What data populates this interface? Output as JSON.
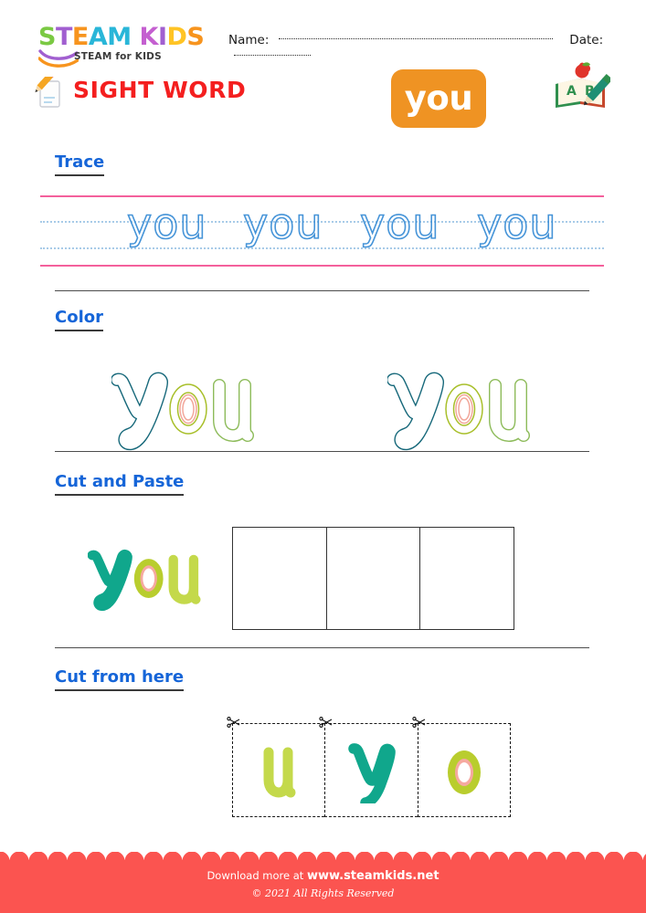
{
  "brand": {
    "logo_letters": [
      {
        "ch": "S",
        "color": "#7ac943"
      },
      {
        "ch": "T",
        "color": "#a15fd0"
      },
      {
        "ch": "E",
        "color": "#f7941e"
      },
      {
        "ch": "A",
        "color": "#29b6d8"
      },
      {
        "ch": "M",
        "color": "#29b6d8"
      },
      {
        "ch": " ",
        "color": "#ffffff"
      },
      {
        "ch": "K",
        "color": "#c45fd0"
      },
      {
        "ch": "I",
        "color": "#a15fd0"
      },
      {
        "ch": "D",
        "color": "#ffc425"
      },
      {
        "ch": "S",
        "color": "#f7941e"
      }
    ],
    "logo_text": "STEAM KIDS",
    "tagline": "STEAM for KIDS"
  },
  "header": {
    "name_label": "Name:",
    "date_label": "Date:",
    "name_value": "",
    "date_value": "",
    "title": "SIGHT WORD",
    "title_color": "#f41f1f",
    "word_badge": "you",
    "word_badge_color": "#ef9323",
    "pencil_icon": "pencil-paper-icon",
    "abc_icon": "abc-book-apple-pencil-icon"
  },
  "sections": [
    {
      "id": "trace",
      "label": "Trace"
    },
    {
      "id": "color",
      "label": "Color"
    },
    {
      "id": "cut-and-paste",
      "label": "Cut and Paste"
    },
    {
      "id": "cut-from-here",
      "label": "Cut from here"
    }
  ],
  "trace": {
    "label": "Trace",
    "word": "you",
    "repetitions": 4,
    "words": [
      "you",
      "you",
      "you",
      "you"
    ],
    "rule_color": "#f4609c",
    "guide_color": "#a8cbe8",
    "stroke_color": "#3d8fd6"
  },
  "color": {
    "label": "Color",
    "word": "you",
    "repetitions": 2,
    "letters": [
      {
        "ch": "y",
        "outline": "#16687a"
      },
      {
        "ch": "o",
        "outline": "#a8bf2a",
        "inner_outline": "#f2a79a"
      },
      {
        "ch": "u",
        "outline": "#8dbb5a"
      }
    ]
  },
  "cut_and_paste": {
    "label": "Cut and Paste",
    "word": "you",
    "letters": [
      {
        "ch": "y",
        "fill": "#10a78c"
      },
      {
        "ch": "o",
        "fill": "#b9cd2e",
        "inner_fill": "#f6a9a0"
      },
      {
        "ch": "u",
        "fill": "#c4d94b"
      }
    ],
    "box_count": 3,
    "boxes": [
      "",
      "",
      ""
    ]
  },
  "cut_from_here": {
    "label": "Cut from here",
    "cells": [
      {
        "ch": "u",
        "fill": "#c4d94b"
      },
      {
        "ch": "y",
        "fill": "#10a78c"
      },
      {
        "ch": "o",
        "fill": "#b9cd2e",
        "inner_fill": "#f6a9a0"
      }
    ],
    "scissors_icon": "scissors-icon"
  },
  "footer": {
    "download_prefix": "Download more at ",
    "website": "www.steamkids.net",
    "copyright": "© 2021 All Rights Reserved",
    "background": "#fb5450"
  }
}
